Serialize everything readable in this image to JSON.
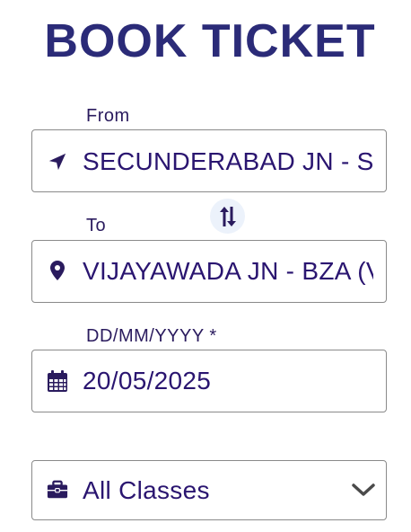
{
  "header": {
    "title": "BOOK TICKET"
  },
  "from": {
    "label": "From",
    "value": "SECUNDERABAD JN - SC (SECUNDERABAD)",
    "icon": "navigation-arrow-icon"
  },
  "swap": {
    "icon": "swap-vertical-icon"
  },
  "to": {
    "label": "To",
    "value": "VIJAYAWADA JN - BZA (VIJAYAWADA)",
    "icon": "map-marker-icon"
  },
  "date": {
    "label": "DD/MM/YYYY *",
    "value": "20/05/2025",
    "icon": "calendar-icon"
  },
  "class_select": {
    "value": "All Classes",
    "icon": "briefcase-icon",
    "dropdown_icon": "chevron-down-icon"
  },
  "colors": {
    "title": "#2b2b78",
    "text": "#2a1570",
    "icon": "#2a1b5e",
    "border": "#8a8a8a",
    "swap_bg": "#ecf2fb"
  }
}
